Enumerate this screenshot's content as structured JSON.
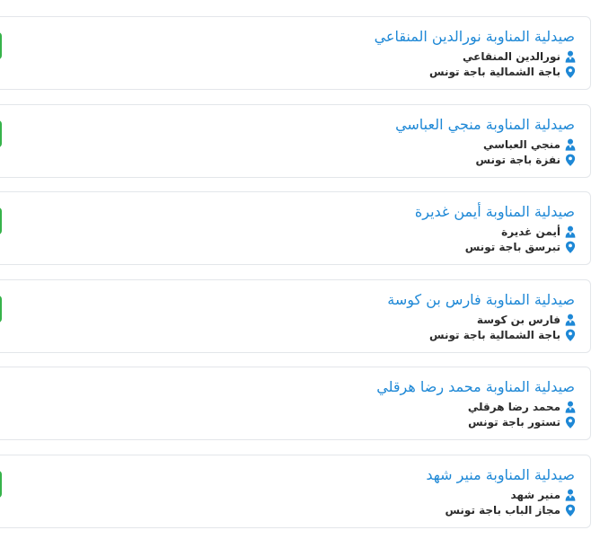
{
  "accent_color": "#36b34a",
  "title_color": "#1e88d6",
  "icon_color": "#1e88d6",
  "pharmacies": [
    {
      "title": "صيدلية المناوبة نورالدين المنقاعي",
      "owner": "نورالدين المنقاعي",
      "location": "باجة الشمالية باجة تونس",
      "status_indicator": true
    },
    {
      "title": "صيدلية المناوبة منجي العباسي",
      "owner": "منجي العباسي",
      "location": "نفزة باجة تونس",
      "status_indicator": true
    },
    {
      "title": "صيدلية المناوبة أيمن غديرة",
      "owner": "أيمن غديرة",
      "location": "تبرسق باجة تونس",
      "status_indicator": true
    },
    {
      "title": "صيدلية المناوبة فارس بن كوسة",
      "owner": "فارس بن كوسة",
      "location": "باجة الشمالية باجة تونس",
      "status_indicator": true
    },
    {
      "title": "صيدلية المناوبة محمد رضا هرقلي",
      "owner": "محمد رضا هرقلي",
      "location": "تستور باجة تونس",
      "status_indicator": false
    },
    {
      "title": "صيدلية المناوبة منير شهد",
      "owner": "منير شهد",
      "location": "مجاز الباب باجة تونس",
      "status_indicator": true
    }
  ]
}
